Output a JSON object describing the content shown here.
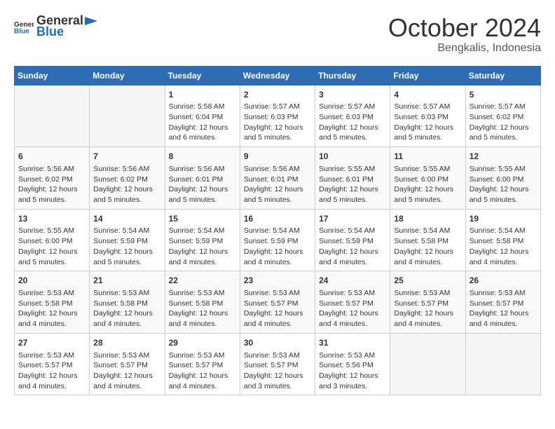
{
  "header": {
    "logo": {
      "text_general": "General",
      "text_blue": "Blue"
    },
    "title": "October 2024",
    "subtitle": "Bengkalis, Indonesia"
  },
  "days_of_week": [
    "Sunday",
    "Monday",
    "Tuesday",
    "Wednesday",
    "Thursday",
    "Friday",
    "Saturday"
  ],
  "weeks": [
    [
      {
        "day": "",
        "info": ""
      },
      {
        "day": "",
        "info": ""
      },
      {
        "day": "1",
        "info": "Sunrise: 5:58 AM\nSunset: 6:04 PM\nDaylight: 12 hours and 6 minutes."
      },
      {
        "day": "2",
        "info": "Sunrise: 5:57 AM\nSunset: 6:03 PM\nDaylight: 12 hours and 5 minutes."
      },
      {
        "day": "3",
        "info": "Sunrise: 5:57 AM\nSunset: 6:03 PM\nDaylight: 12 hours and 5 minutes."
      },
      {
        "day": "4",
        "info": "Sunrise: 5:57 AM\nSunset: 6:03 PM\nDaylight: 12 hours and 5 minutes."
      },
      {
        "day": "5",
        "info": "Sunrise: 5:57 AM\nSunset: 6:02 PM\nDaylight: 12 hours and 5 minutes."
      }
    ],
    [
      {
        "day": "6",
        "info": "Sunrise: 5:56 AM\nSunset: 6:02 PM\nDaylight: 12 hours and 5 minutes."
      },
      {
        "day": "7",
        "info": "Sunrise: 5:56 AM\nSunset: 6:02 PM\nDaylight: 12 hours and 5 minutes."
      },
      {
        "day": "8",
        "info": "Sunrise: 5:56 AM\nSunset: 6:01 PM\nDaylight: 12 hours and 5 minutes."
      },
      {
        "day": "9",
        "info": "Sunrise: 5:56 AM\nSunset: 6:01 PM\nDaylight: 12 hours and 5 minutes."
      },
      {
        "day": "10",
        "info": "Sunrise: 5:55 AM\nSunset: 6:01 PM\nDaylight: 12 hours and 5 minutes."
      },
      {
        "day": "11",
        "info": "Sunrise: 5:55 AM\nSunset: 6:00 PM\nDaylight: 12 hours and 5 minutes."
      },
      {
        "day": "12",
        "info": "Sunrise: 5:55 AM\nSunset: 6:00 PM\nDaylight: 12 hours and 5 minutes."
      }
    ],
    [
      {
        "day": "13",
        "info": "Sunrise: 5:55 AM\nSunset: 6:00 PM\nDaylight: 12 hours and 5 minutes."
      },
      {
        "day": "14",
        "info": "Sunrise: 5:54 AM\nSunset: 5:59 PM\nDaylight: 12 hours and 5 minutes."
      },
      {
        "day": "15",
        "info": "Sunrise: 5:54 AM\nSunset: 5:59 PM\nDaylight: 12 hours and 4 minutes."
      },
      {
        "day": "16",
        "info": "Sunrise: 5:54 AM\nSunset: 5:59 PM\nDaylight: 12 hours and 4 minutes."
      },
      {
        "day": "17",
        "info": "Sunrise: 5:54 AM\nSunset: 5:59 PM\nDaylight: 12 hours and 4 minutes."
      },
      {
        "day": "18",
        "info": "Sunrise: 5:54 AM\nSunset: 5:58 PM\nDaylight: 12 hours and 4 minutes."
      },
      {
        "day": "19",
        "info": "Sunrise: 5:54 AM\nSunset: 5:58 PM\nDaylight: 12 hours and 4 minutes."
      }
    ],
    [
      {
        "day": "20",
        "info": "Sunrise: 5:53 AM\nSunset: 5:58 PM\nDaylight: 12 hours and 4 minutes."
      },
      {
        "day": "21",
        "info": "Sunrise: 5:53 AM\nSunset: 5:58 PM\nDaylight: 12 hours and 4 minutes."
      },
      {
        "day": "22",
        "info": "Sunrise: 5:53 AM\nSunset: 5:58 PM\nDaylight: 12 hours and 4 minutes."
      },
      {
        "day": "23",
        "info": "Sunrise: 5:53 AM\nSunset: 5:57 PM\nDaylight: 12 hours and 4 minutes."
      },
      {
        "day": "24",
        "info": "Sunrise: 5:53 AM\nSunset: 5:57 PM\nDaylight: 12 hours and 4 minutes."
      },
      {
        "day": "25",
        "info": "Sunrise: 5:53 AM\nSunset: 5:57 PM\nDaylight: 12 hours and 4 minutes."
      },
      {
        "day": "26",
        "info": "Sunrise: 5:53 AM\nSunset: 5:57 PM\nDaylight: 12 hours and 4 minutes."
      }
    ],
    [
      {
        "day": "27",
        "info": "Sunrise: 5:53 AM\nSunset: 5:57 PM\nDaylight: 12 hours and 4 minutes."
      },
      {
        "day": "28",
        "info": "Sunrise: 5:53 AM\nSunset: 5:57 PM\nDaylight: 12 hours and 4 minutes."
      },
      {
        "day": "29",
        "info": "Sunrise: 5:53 AM\nSunset: 5:57 PM\nDaylight: 12 hours and 4 minutes."
      },
      {
        "day": "30",
        "info": "Sunrise: 5:53 AM\nSunset: 5:57 PM\nDaylight: 12 hours and 3 minutes."
      },
      {
        "day": "31",
        "info": "Sunrise: 5:53 AM\nSunset: 5:56 PM\nDaylight: 12 hours and 3 minutes."
      },
      {
        "day": "",
        "info": ""
      },
      {
        "day": "",
        "info": ""
      }
    ]
  ]
}
